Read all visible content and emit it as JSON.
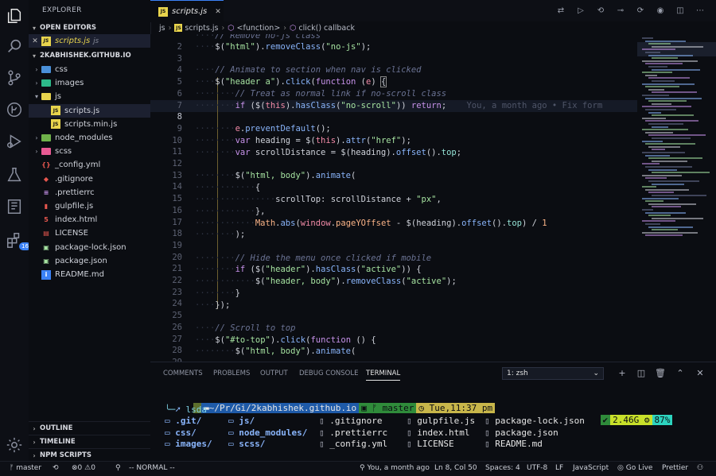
{
  "sidebar": {
    "title": "EXPLORER",
    "open_editors": {
      "label": "OPEN EDITORS",
      "items": [
        {
          "name": "scripts.js",
          "folder": "js"
        }
      ]
    },
    "workspace": "2KABHISHEK.GITHUB.IO",
    "tree": [
      {
        "name": "css",
        "kind": "folder"
      },
      {
        "name": "images",
        "kind": "folder"
      },
      {
        "name": "js",
        "kind": "folder-open"
      },
      {
        "name": "scripts.js",
        "kind": "js",
        "indent": 2
      },
      {
        "name": "scripts.min.js",
        "kind": "js",
        "indent": 2
      },
      {
        "name": "node_modules",
        "kind": "folder"
      },
      {
        "name": "scss",
        "kind": "folder"
      },
      {
        "name": "_config.yml",
        "kind": "yml"
      },
      {
        "name": ".gitignore",
        "kind": "git"
      },
      {
        "name": ".prettierrc",
        "kind": "prettier"
      },
      {
        "name": "gulpfile.js",
        "kind": "gulp"
      },
      {
        "name": "index.html",
        "kind": "html"
      },
      {
        "name": "LICENSE",
        "kind": "license"
      },
      {
        "name": "package-lock.json",
        "kind": "json"
      },
      {
        "name": "package.json",
        "kind": "json"
      },
      {
        "name": "README.md",
        "kind": "info"
      }
    ],
    "bottom_sections": [
      "OUTLINE",
      "TIMELINE",
      "NPM SCRIPTS"
    ],
    "extensions_badge": "16"
  },
  "editor": {
    "tab_label": "scripts.js",
    "breadcrumb": [
      "js",
      "scripts.js",
      "<function>",
      "click() callback"
    ],
    "blame": "You, a month ago • Fix form",
    "line_numbers": [
      "2",
      "3",
      "4",
      "5",
      "6",
      "7",
      "8",
      "9",
      "10",
      "11",
      "12",
      "13",
      "14",
      "15",
      "16",
      "17",
      "18",
      "19",
      "20",
      "21",
      "22",
      "23",
      "24",
      "25",
      "26",
      "27",
      "28",
      "29",
      "30"
    ]
  },
  "panel": {
    "tabs": [
      "COMMENTS",
      "PROBLEMS",
      "OUTPUT",
      "DEBUG CONSOLE",
      "TERMINAL"
    ],
    "active_tab": "TERMINAL",
    "terminal_select": "1: zsh",
    "prompt": {
      "path": "~/Pr/Gi/2kabhishek.github.io",
      "branch": "master",
      "time": "Tue,11:37 pm",
      "command": "lsda",
      "memory": "2.46G",
      "battery": "87%"
    },
    "listing": [
      [
        ".git/",
        "js/",
        ".gitignore",
        "gulpfile.js",
        "package-lock.json"
      ],
      [
        "css/",
        "node_modules/",
        ".prettierrc",
        "index.html",
        "package.json"
      ],
      [
        "images/",
        "scss/",
        "_config.yml",
        "LICENSE",
        "README.md"
      ]
    ]
  },
  "status": {
    "branch": "master",
    "errors": "0",
    "warnings": "0",
    "mode": "-- NORMAL --",
    "blame": "You, a month ago",
    "position": "Ln 8, Col 50",
    "spaces": "Spaces: 4",
    "encoding": "UTF-8",
    "eol": "LF",
    "language": "JavaScript",
    "golive": "Go Live",
    "prettier": "Prettier"
  },
  "colors": {
    "accent": "#3b82f6",
    "background": "#0b0d12",
    "string": "#a6e3a1",
    "function": "#89b4fa",
    "keyword": "#c792ea"
  }
}
